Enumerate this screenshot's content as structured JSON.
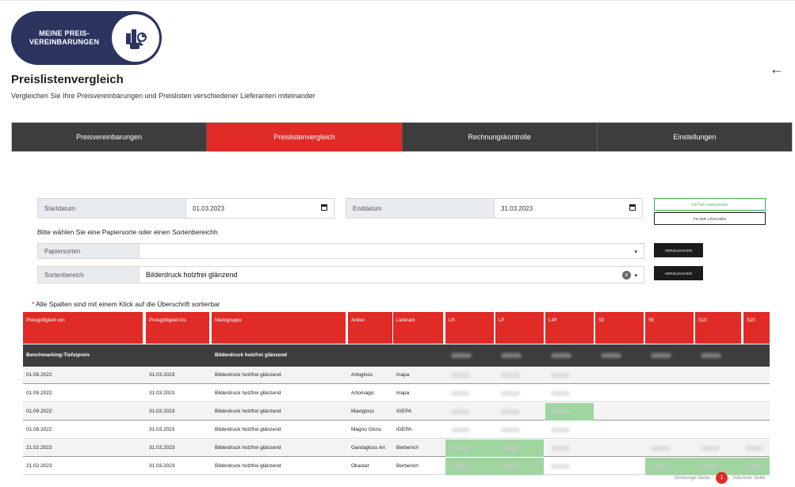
{
  "logo": {
    "text_line1": "MEINE PREIS-",
    "text_line2": "VEREINBARUNGEN",
    "icon": "price-agreement-icon"
  },
  "header": {
    "title": "Preislistenvergleich",
    "subtitle": "Vergleichen Sie Ihre Preisvereinbarungen und Preislisten verschiedener Lieferanten miteinander",
    "back_icon": "arrow-left-icon"
  },
  "tabs": [
    {
      "label": "Preisvereinbarungen",
      "active": false
    },
    {
      "label": "Preislistenvergleich",
      "active": true
    },
    {
      "label": "Rechnungskontrolle",
      "active": false
    },
    {
      "label": "Einstellungen",
      "active": false
    }
  ],
  "filters": {
    "start_label": "Startdatum",
    "start_value": "01.03.2023",
    "end_label": "Enddatum",
    "end_value": "31.03.2023",
    "apply_label": "FILTER ANWENDEN",
    "clear_label": "FILTER LÖSCHEN",
    "hint": "Bitte wählen Sie eine Papiersorte oder einen Sortenbereichh",
    "papiersorten_label": "Papiersorten",
    "papiersorten_value": "",
    "sortenbereich_label": "Sortenbereich",
    "sortenbereich_value": "Bilderdruck holzfrei glänzend",
    "compare_label": "VERGLEICHEN"
  },
  "table": {
    "note": "Alle Spalten sind mit einem Klick auf die Überschrift sortierbar",
    "columns": [
      "Preisgültigkeit von",
      "Preisgültigkeit bis",
      "Marktgruppe",
      "Artikel",
      "Lieferant",
      "LR",
      "LP",
      "L4P",
      "S3",
      "S5",
      "S10",
      "S20"
    ],
    "benchmark": {
      "label": "Benchmarking-Tiefstpreis",
      "marktgruppe": "Bilderdruck holzfrei glänzend"
    },
    "rows": [
      {
        "von": "01.09.2022",
        "bis": "31.03.2023",
        "markt": "Bilderdruck holzfrei glänzend",
        "artikel": "Artogloss",
        "lieferant": "Inapa"
      },
      {
        "von": "01.09.2022",
        "bis": "31.03.2023",
        "markt": "Bilderdruck holzfrei glänzend",
        "artikel": "Artomagic",
        "lieferant": "Inapa"
      },
      {
        "von": "01.09.2022",
        "bis": "31.03.2023",
        "markt": "Bilderdruck holzfrei glänzend",
        "artikel": "Maxigloss",
        "lieferant": "IGEPA"
      },
      {
        "von": "01.09.2022",
        "bis": "31.03.2023",
        "markt": "Bilderdruck holzfrei glänzend",
        "artikel": "Magno Gloss",
        "lieferant": "IGEPA"
      },
      {
        "von": "21.02.2023",
        "bis": "31.03.2023",
        "markt": "Bilderdruck holzfrei glänzend",
        "artikel": "Gardagloss Art",
        "lieferant": "Berberich"
      },
      {
        "von": "21.02.2023",
        "bis": "31.03.2023",
        "markt": "Bilderdruck holzfrei glänzend",
        "artikel": "Okastar",
        "lieferant": "Berberich"
      }
    ]
  },
  "pagination": {
    "prev_label": "Vorherige Seite",
    "page": "1",
    "next_label": "Nächste Seite"
  },
  "colors": {
    "accent": "#e02b27",
    "dark": "#3d3d3d",
    "highlight": "#9fd6a0",
    "navy": "#2c3560"
  }
}
